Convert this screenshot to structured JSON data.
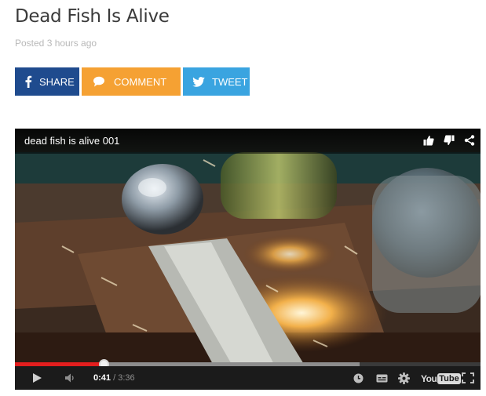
{
  "post": {
    "title": "Dead Fish Is Alive",
    "meta": "Posted 3 hours ago"
  },
  "share": {
    "facebook_label": "SHARE",
    "comment_label": "COMMENT",
    "tweet_label": "TWEET",
    "colors": {
      "facebook": "#1f4b8e",
      "comment": "#f5a133",
      "twitter": "#3aa4e0"
    }
  },
  "video": {
    "title": "dead fish is alive 001",
    "current_time": "0:41",
    "separator": " / ",
    "duration": "3:36",
    "played_fraction": 0.19,
    "buffered_fraction": 0.74,
    "logo_you": "You",
    "logo_tube": "Tube",
    "top_icons": [
      "thumbs-up-icon",
      "thumbs-down-icon",
      "share-icon"
    ],
    "control_icons": [
      "play-icon",
      "volume-icon",
      "watch-later-icon",
      "captions-icon",
      "settings-icon",
      "fullscreen-icon"
    ],
    "progress_color": "#e31e1e"
  }
}
